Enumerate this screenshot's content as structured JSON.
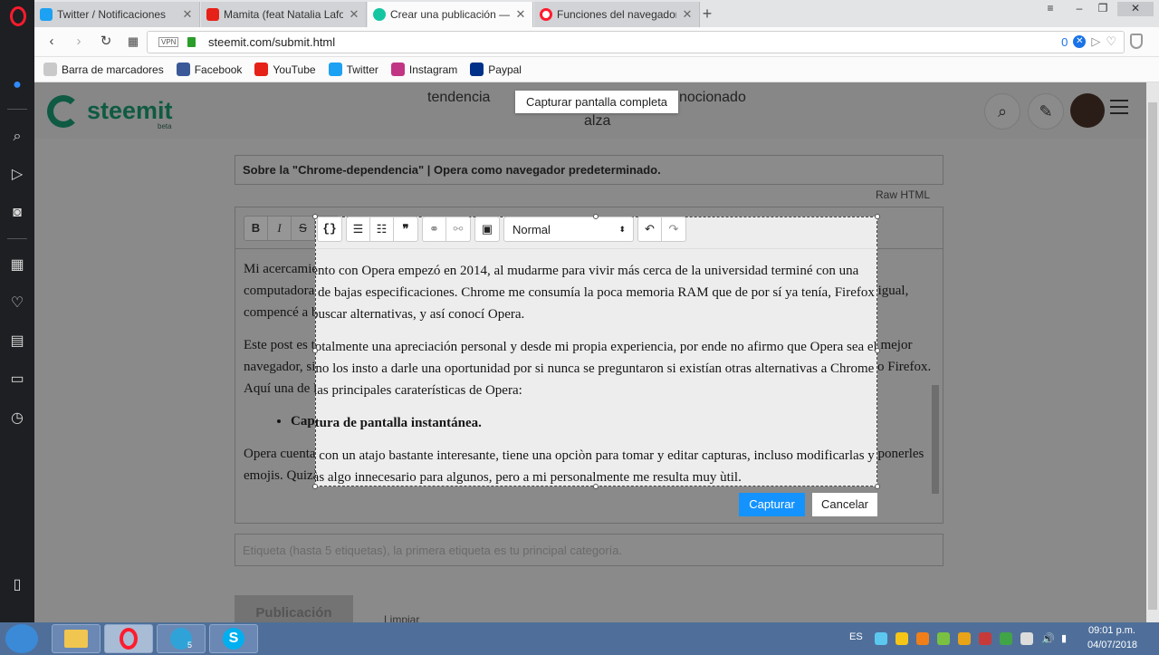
{
  "browser": {
    "tabs": [
      {
        "title": "Twitter / Notificaciones",
        "icon": "twitter-icon",
        "color": "#1da1f2"
      },
      {
        "title": "Mamita (feat Natalia Lafou",
        "icon": "youtube-icon",
        "color": "#e62117"
      },
      {
        "title": "Crear una publicación — S",
        "icon": "steemit-icon",
        "color": "#13c6a1",
        "active": true
      },
      {
        "title": "Funciones del navegador",
        "icon": "opera-icon",
        "color": "#ff1b2d"
      }
    ],
    "url": "steemit.com/submit.html",
    "vpn_label": "VPN",
    "adblock_count": "0",
    "bookmarks": [
      {
        "label": "Barra de marcadores",
        "icon": "folder-icon",
        "color": "#c9c9c9"
      },
      {
        "label": "Facebook",
        "icon": "facebook-icon",
        "color": "#3b5998"
      },
      {
        "label": "YouTube",
        "icon": "youtube-icon",
        "color": "#e62117"
      },
      {
        "label": "Twitter",
        "icon": "twitter-icon",
        "color": "#1da1f2"
      },
      {
        "label": "Instagram",
        "icon": "instagram-icon",
        "color": "#c13584"
      },
      {
        "label": "Paypal",
        "icon": "paypal-icon",
        "color": "#003087"
      }
    ]
  },
  "steemit": {
    "logo": "steemit",
    "beta": "beta",
    "nav": [
      "tendencia",
      "nocionado",
      "alza"
    ],
    "title_value": "Sobre la \"Chrome-dependencia\"  |  Opera como navegador predeterminado.",
    "raw_html": "Raw HTML",
    "format_select": "Normal",
    "paragraph_1": "Mi acercamiento con Opera empezó en 2014, al mudarme para vivir más cerca de la universidad terminé con una computadora de bajas especificaciones. Chrome me consumía la poca memoria RAM que de por sí ya tenía, Firefox igual, compencé a buscar alternativas, y así conocí Opera.",
    "paragraph_2": "Este post es totalmente una apreciación personal y desde mi propia experiencia, por ende no afirmo que Opera sea el mejor navegador, sino los insto a darle una oportunidad por si nunca se preguntaron si existían otras alternativas a Chrome o Firefox. Aquí una de las principales caraterísticas de Opera:",
    "bullet_1": "Captura de pantalla instantánea.",
    "paragraph_3": "Opera cuenta con un atajo bastante interesante, tiene una opciòn para tomar y editar capturas, incluso modificarlas y ponerles emojis. Quizàs algo innecesario para algunos, pero a mi personalmente me resulta muy ùtil.",
    "tags_placeholder": "Etiqueta (hasta 5 etiquetas), la primera etiqueta es tu principal categoría.",
    "publish": "Publicación",
    "clear": "Limpiar"
  },
  "capture": {
    "tooltip": "Capturar pantalla completa",
    "capture_button": "Capturar",
    "cancel_button": "Cancelar"
  },
  "taskbar": {
    "language": "ES",
    "time": "09:01 p.m.",
    "date": "04/07/2018",
    "telegram_badge": "5"
  }
}
